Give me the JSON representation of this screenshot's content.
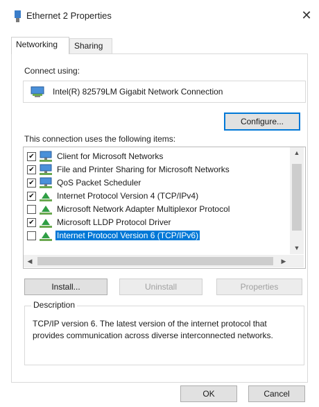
{
  "window": {
    "title": "Ethernet 2 Properties",
    "close_glyph": "✕"
  },
  "tabs": [
    {
      "label": "Networking"
    },
    {
      "label": "Sharing"
    }
  ],
  "connect_using": {
    "label": "Connect using:",
    "adapter": "Intel(R) 82579LM Gigabit Network Connection",
    "icon": "network-adapter-icon"
  },
  "configure_label": "Configure...",
  "items_label": "This connection uses the following items:",
  "items": [
    {
      "label": "Client for Microsoft Networks",
      "checked": true,
      "icon": "client-network-icon",
      "selected": false
    },
    {
      "label": "File and Printer Sharing for Microsoft Networks",
      "checked": true,
      "icon": "client-network-icon",
      "selected": false
    },
    {
      "label": "QoS Packet Scheduler",
      "checked": true,
      "icon": "client-network-icon",
      "selected": false
    },
    {
      "label": "Internet Protocol Version 4 (TCP/IPv4)",
      "checked": true,
      "icon": "protocol-icon",
      "selected": false
    },
    {
      "label": "Microsoft Network Adapter Multiplexor Protocol",
      "checked": false,
      "icon": "protocol-icon",
      "selected": false
    },
    {
      "label": "Microsoft LLDP Protocol Driver",
      "checked": true,
      "icon": "protocol-icon",
      "selected": false
    },
    {
      "label": "Internet Protocol Version 6 (TCP/IPv6)",
      "checked": false,
      "icon": "protocol-icon",
      "selected": true
    }
  ],
  "scroll": {
    "up": "▲",
    "down": "▼",
    "left": "◀",
    "right": "▶"
  },
  "buttons": {
    "install": "Install...",
    "uninstall": "Uninstall",
    "properties": "Properties"
  },
  "description": {
    "legend": "Description",
    "text": "TCP/IP version 6. The latest version of the internet protocol that provides communication across diverse interconnected networks."
  },
  "dialog_buttons": {
    "ok": "OK",
    "cancel": "Cancel"
  },
  "colors": {
    "accent": "#0078d7"
  }
}
